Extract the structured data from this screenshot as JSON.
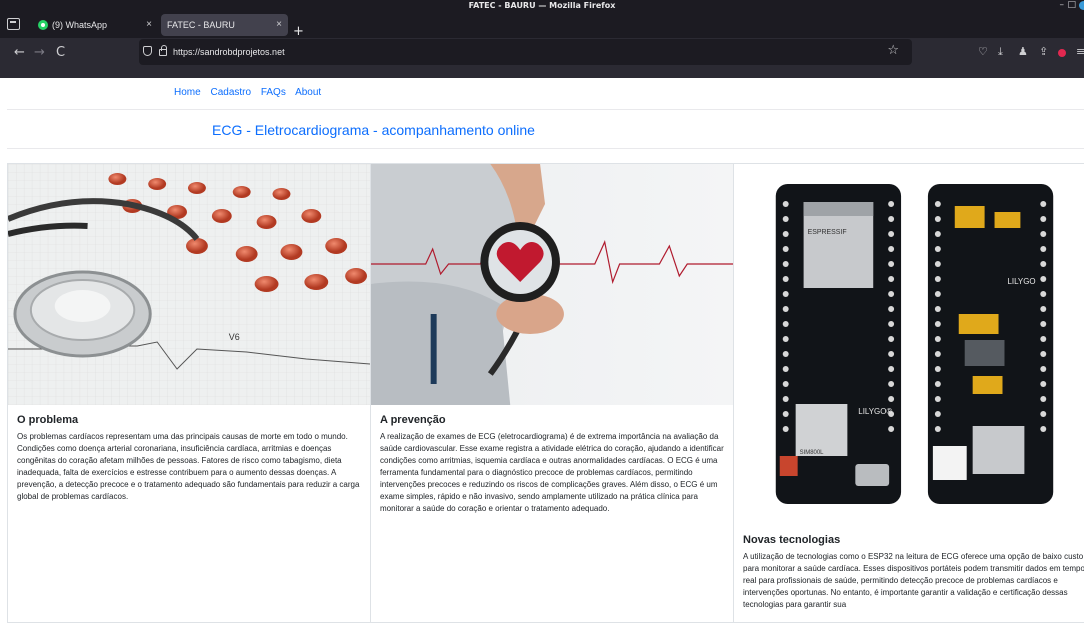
{
  "window": {
    "title": "FATEC - BAURU — Mozilla Firefox",
    "minimize": "–",
    "maximize": "□"
  },
  "tabs": [
    {
      "label": "(9) WhatsApp",
      "close": "×"
    },
    {
      "label": "FATEC - BAURU",
      "close": "×"
    }
  ],
  "toolbar": {
    "back": "←",
    "forward": "→",
    "reload": "C",
    "url": "https://sandrobdprojetos.net",
    "new_tab": "+",
    "bookmark_star": "☆",
    "pocket": "♡",
    "download": "⤓",
    "extensions": "♟",
    "share": "⇪",
    "menu": "≡"
  },
  "icons": {
    "tab_overview": "tab-overview-icon",
    "whatsapp": "whatsapp-icon",
    "shield": "shield-icon",
    "lock": "lock-icon"
  },
  "colors": {
    "link": "#0d6efd",
    "chrome_dark": "#1c1b22",
    "chrome_toolbar": "#2b2a33",
    "active_tab": "#42414d",
    "whatsapp_green": "#25d366"
  },
  "site": {
    "nav": [
      "Home",
      "Cadastro",
      "FAQs",
      "About"
    ],
    "headline": "ECG - Eletrocardiograma - acompanhamento online"
  },
  "cards": [
    {
      "title": "O problema",
      "text": "Os problemas cardíacos representam uma das principais causas de morte em todo o mundo. Condições como doença arterial coronariana, insuficiência cardíaca, arritmias e doenças congênitas do coração afetam milhões de pessoas. Fatores de risco como tabagismo, dieta inadequada, falta de exercícios e estresse contribuem para o aumento dessas doenças. A prevenção, a detecção precoce e o tratamento adequado são fundamentais para reduzir a carga global de problemas cardíacos."
    },
    {
      "title": "A prevenção",
      "text": "A realização de exames de ECG (eletrocardiograma) é de extrema importância na avaliação da saúde cardiovascular. Esse exame registra a atividade elétrica do coração, ajudando a identificar condições como arritmias, isquemia cardíaca e outras anormalidades cardíacas. O ECG é uma ferramenta fundamental para o diagnóstico precoce de problemas cardíacos, permitindo intervenções precoces e reduzindo os riscos de complicações graves. Além disso, o ECG é um exame simples, rápido e não invasivo, sendo amplamente utilizado na prática clínica para monitorar a saúde do coração e orientar o tratamento adequado."
    },
    {
      "title": "Novas tecnologias",
      "text": "A utilização de tecnologias como o ESP32 na leitura de ECG oferece uma opção de baixo custo para monitorar a saúde cardíaca. Esses dispositivos portáteis podem transmitir dados em tempo real para profissionais de saúde, permitindo detecção precoce de problemas cardíacos e intervenções oportunas. No entanto, é importante garantir a validação e certificação dessas tecnologias para garantir sua"
    }
  ],
  "images": {
    "card1_ecg_label": "V6",
    "board_labels": [
      "ESPRESSIF",
      "LILYGO®",
      "SIM800L",
      "LILYGO"
    ]
  }
}
